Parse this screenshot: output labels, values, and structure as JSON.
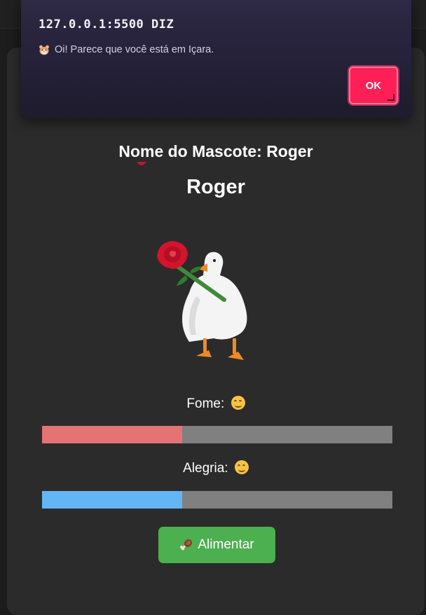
{
  "dialog": {
    "title": "127.0.0.1:5500 DIZ",
    "message": "Oi! Parece que você está em Içara.",
    "message_icon": "hamster-face-icon",
    "ok_label": "OK"
  },
  "pet": {
    "subtitle": "Nome do Mascote: Roger",
    "name": "Roger",
    "image": "goose-with-rose"
  },
  "stats": [
    {
      "label": "Fome:",
      "mood_icon": "smiling-face-icon",
      "value_percent": 40,
      "color": "#e57373"
    },
    {
      "label": "Alegria:",
      "mood_icon": "smiling-face-icon",
      "value_percent": 40,
      "color": "#64b5f6"
    }
  ],
  "actions": {
    "feed_label": "Alimentar",
    "feed_icon": "meat-on-bone-icon",
    "feed_color": "#4caf50"
  },
  "colors": {
    "card_bg": "#2b2b2b",
    "bar_track": "#808080",
    "ok_button": "#ff1f57"
  }
}
